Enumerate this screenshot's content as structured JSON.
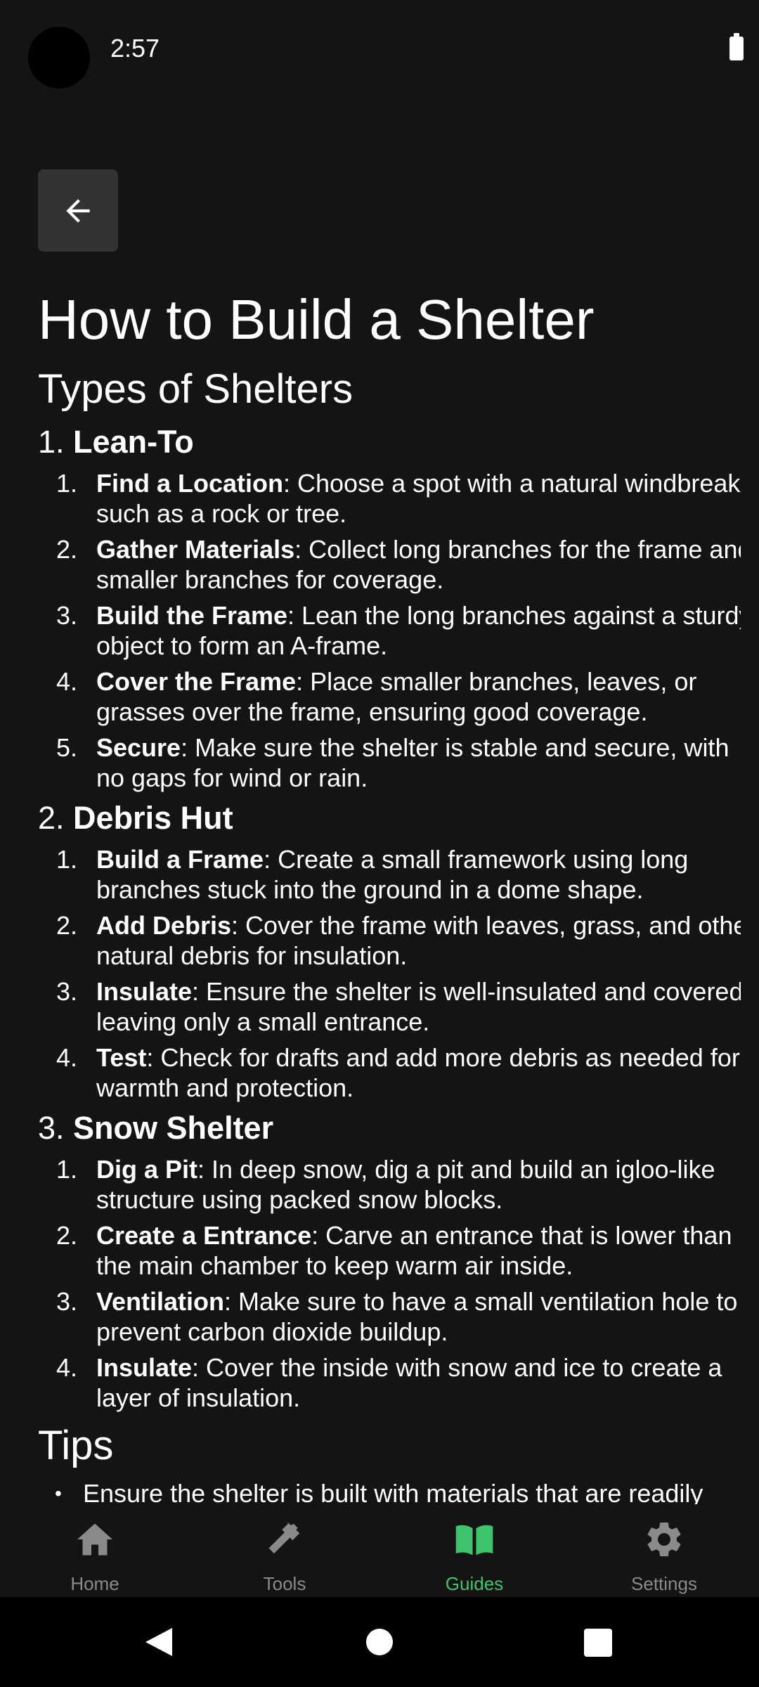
{
  "status_bar": {
    "time": "2:57"
  },
  "header": {
    "title": "How to Build a Shelter"
  },
  "types_section": {
    "title": "Types of Shelters",
    "shelters": [
      {
        "number": "1.",
        "name": "Lean-To",
        "steps": [
          {
            "num": "1.",
            "title": "Find a Location",
            "text": ": Choose a spot with a natural windbreak, such as a rock or tree."
          },
          {
            "num": "2.",
            "title": "Gather Materials",
            "text": ": Collect long branches for the frame and smaller branches for coverage."
          },
          {
            "num": "3.",
            "title": "Build the Frame",
            "text": ": Lean the long branches against a sturdy object to form an A-frame."
          },
          {
            "num": "4.",
            "title": "Cover the Frame",
            "text": ": Place smaller branches, leaves, or grasses over the frame, ensuring good coverage."
          },
          {
            "num": "5.",
            "title": "Secure",
            "text": ": Make sure the shelter is stable and secure, with no gaps for wind or rain."
          }
        ]
      },
      {
        "number": "2.",
        "name": "Debris Hut",
        "steps": [
          {
            "num": "1.",
            "title": "Build a Frame",
            "text": ": Create a small framework using long branches stuck into the ground in a dome shape."
          },
          {
            "num": "2.",
            "title": "Add Debris",
            "text": ": Cover the frame with leaves, grass, and other natural debris for insulation."
          },
          {
            "num": "3.",
            "title": "Insulate",
            "text": ": Ensure the shelter is well-insulated and covered, leaving only a small entrance."
          },
          {
            "num": "4.",
            "title": "Test",
            "text": ": Check for drafts and add more debris as needed for warmth and protection."
          }
        ]
      },
      {
        "number": "3.",
        "name": "Snow Shelter",
        "steps": [
          {
            "num": "1.",
            "title": "Dig a Pit",
            "text": ": In deep snow, dig a pit and build an igloo-like structure using packed snow blocks."
          },
          {
            "num": "2.",
            "title": "Create a Entrance",
            "text": ": Carve an entrance that is lower than the main chamber to keep warm air inside."
          },
          {
            "num": "3.",
            "title": "Ventilation",
            "text": ": Make sure to have a small ventilation hole to prevent carbon dioxide buildup."
          },
          {
            "num": "4.",
            "title": "Insulate",
            "text": ": Cover the inside with snow and ice to create a layer of insulation."
          }
        ]
      }
    ]
  },
  "tips_section": {
    "title": "Tips",
    "items": [
      "Ensure the shelter is built with materials that are readily"
    ]
  },
  "bottom_nav": {
    "items": [
      {
        "label": "Home",
        "icon": "home-icon"
      },
      {
        "label": "Tools",
        "icon": "hammer-icon"
      },
      {
        "label": "Guides",
        "icon": "book-icon",
        "active": true
      },
      {
        "label": "Settings",
        "icon": "gear-icon"
      }
    ]
  },
  "colors": {
    "background": "#141414",
    "accent": "#3ec46d",
    "inactive": "#8a8a8a",
    "button": "#333333"
  }
}
